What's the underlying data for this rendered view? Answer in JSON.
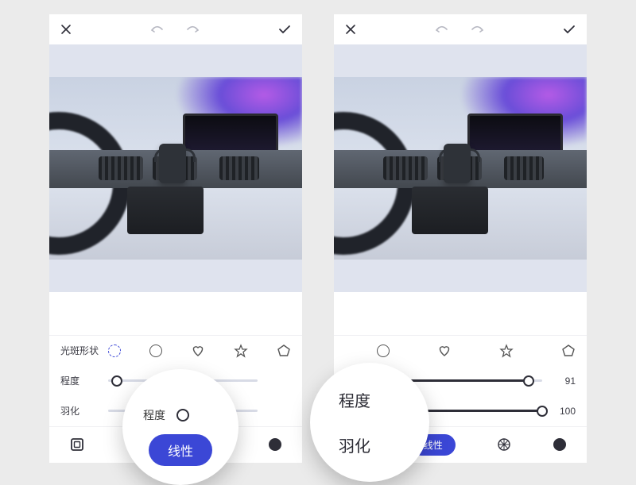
{
  "topbar": {
    "close_icon": "close-icon",
    "undo_icon": "undo-icon",
    "redo_icon": "redo-icon",
    "confirm_icon": "check-icon"
  },
  "shape_row": {
    "label": "光斑形状",
    "options": [
      "dashed-circle",
      "circle",
      "heart",
      "star",
      "pentagon"
    ]
  },
  "sliders": {
    "degree": {
      "label": "程度"
    },
    "feather": {
      "label": "羽化"
    }
  },
  "right": {
    "degree_value": "91",
    "feather_value": "100"
  },
  "linear_label": "线性",
  "zoom_right": {
    "label1": "程度",
    "label2": "羽化"
  },
  "bottom_tabs": {
    "square_icon": "square-tool-icon",
    "linear_pill": "线性",
    "radial_icon": "radial-icon",
    "dot_icon": "filled-dot-icon"
  }
}
